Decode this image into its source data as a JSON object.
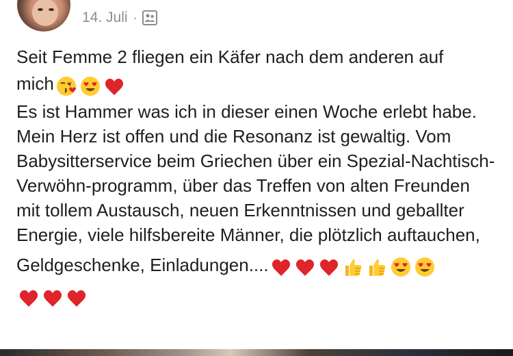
{
  "post": {
    "author_name": "",
    "date": "14. Juli",
    "separator": "·",
    "privacy_icon": "friends-icon",
    "text": {
      "line1": "Seit Femme 2 fliegen ein Käfer nach dem anderen auf",
      "line2": "mich",
      "paragraph": "Es ist Hammer was ich in dieser einen Woche erlebt habe. Mein Herz ist offen und die Resonanz ist gewaltig. Vom Babysitterservice beim Griechen über ein Spezial-Nachtisch-Verwöhn-programm, über das Treffen von alten Freunden mit tollem Austausch, neuen Erkenntnissen und geballter Energie, viele hilfsbereite Männer, die plötzlich auftauchen,",
      "last_line": "Geldgeschenke, Einladungen...."
    },
    "emojis": {
      "after_mich": [
        "kissing-face-icon",
        "heart-eyes-icon",
        "red-heart-icon"
      ],
      "after_einladungen": [
        "red-heart-icon",
        "red-heart-icon",
        "red-heart-icon",
        "thumbs-up-icon",
        "thumbs-up-icon",
        "heart-eyes-icon",
        "heart-eyes-icon"
      ],
      "final_row": [
        "red-heart-icon",
        "red-heart-icon",
        "red-heart-icon"
      ]
    }
  },
  "colors": {
    "text": "#1c1e21",
    "meta": "#8a8d91",
    "heart": "#e0242b",
    "emoji_face": "#ffcc33"
  }
}
